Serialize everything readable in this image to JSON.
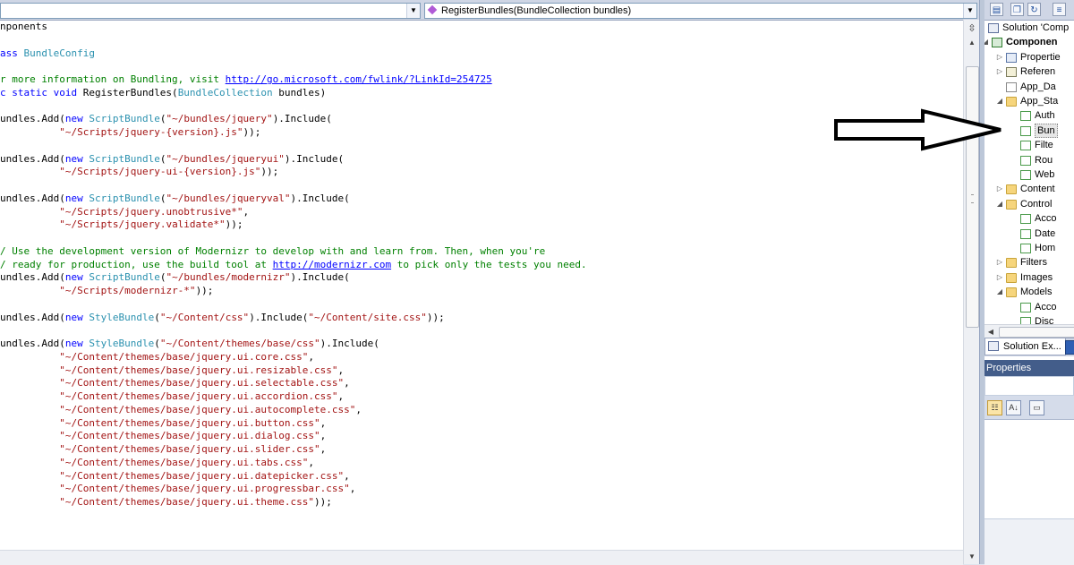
{
  "editor": {
    "type_dropdown": "",
    "member_dropdown": "RegisterBundles(BundleCollection bundles)",
    "code_lines": [
      [
        [
          "nponents",
          ""
        ]
      ],
      [
        [
          "",
          ""
        ]
      ],
      [
        [
          "ass ",
          "k"
        ],
        [
          "BundleConfig",
          "t"
        ]
      ],
      [
        [
          "",
          ""
        ]
      ],
      [
        [
          "r more information on Bundling, visit ",
          "c"
        ],
        [
          "http://go.microsoft.com/fwlink/?LinkId=254725",
          "u"
        ]
      ],
      [
        [
          "c static void ",
          "k"
        ],
        [
          "RegisterBundles(",
          ""
        ],
        [
          "BundleCollection",
          "t"
        ],
        [
          " bundles)",
          ""
        ]
      ],
      [
        [
          "",
          ""
        ]
      ],
      [
        [
          "undles.Add(",
          ""
        ],
        [
          "new ",
          "k"
        ],
        [
          "ScriptBundle",
          "t"
        ],
        [
          "(",
          ""
        ],
        [
          "\"~/bundles/jquery\"",
          "s"
        ],
        [
          ").Include(",
          ""
        ]
      ],
      [
        [
          "          ",
          ""
        ],
        [
          "\"~/Scripts/jquery-{version}.js\"",
          "s"
        ],
        [
          "));",
          ""
        ]
      ],
      [
        [
          "",
          ""
        ]
      ],
      [
        [
          "undles.Add(",
          ""
        ],
        [
          "new ",
          "k"
        ],
        [
          "ScriptBundle",
          "t"
        ],
        [
          "(",
          ""
        ],
        [
          "\"~/bundles/jqueryui\"",
          "s"
        ],
        [
          ").Include(",
          ""
        ]
      ],
      [
        [
          "          ",
          ""
        ],
        [
          "\"~/Scripts/jquery-ui-{version}.js\"",
          "s"
        ],
        [
          "));",
          ""
        ]
      ],
      [
        [
          "",
          ""
        ]
      ],
      [
        [
          "undles.Add(",
          ""
        ],
        [
          "new ",
          "k"
        ],
        [
          "ScriptBundle",
          "t"
        ],
        [
          "(",
          ""
        ],
        [
          "\"~/bundles/jqueryval\"",
          "s"
        ],
        [
          ").Include(",
          ""
        ]
      ],
      [
        [
          "          ",
          ""
        ],
        [
          "\"~/Scripts/jquery.unobtrusive*\"",
          "s"
        ],
        [
          ",",
          ""
        ]
      ],
      [
        [
          "          ",
          ""
        ],
        [
          "\"~/Scripts/jquery.validate*\"",
          "s"
        ],
        [
          "));",
          ""
        ]
      ],
      [
        [
          "",
          ""
        ]
      ],
      [
        [
          "/ Use the development version of Modernizr to develop with and learn from. Then, when you're",
          "c"
        ]
      ],
      [
        [
          "/ ready for production, use the build tool at ",
          "c"
        ],
        [
          "http://modernizr.com",
          "u"
        ],
        [
          " to pick only the tests you need.",
          "c"
        ]
      ],
      [
        [
          "undles.Add(",
          ""
        ],
        [
          "new ",
          "k"
        ],
        [
          "ScriptBundle",
          "t"
        ],
        [
          "(",
          ""
        ],
        [
          "\"~/bundles/modernizr\"",
          "s"
        ],
        [
          ").Include(",
          ""
        ]
      ],
      [
        [
          "          ",
          ""
        ],
        [
          "\"~/Scripts/modernizr-*\"",
          "s"
        ],
        [
          "));",
          ""
        ]
      ],
      [
        [
          "",
          ""
        ]
      ],
      [
        [
          "undles.Add(",
          ""
        ],
        [
          "new ",
          "k"
        ],
        [
          "StyleBundle",
          "t"
        ],
        [
          "(",
          ""
        ],
        [
          "\"~/Content/css\"",
          "s"
        ],
        [
          ").Include(",
          ""
        ],
        [
          "\"~/Content/site.css\"",
          "s"
        ],
        [
          "));",
          ""
        ]
      ],
      [
        [
          "",
          ""
        ]
      ],
      [
        [
          "undles.Add(",
          ""
        ],
        [
          "new ",
          "k"
        ],
        [
          "StyleBundle",
          "t"
        ],
        [
          "(",
          ""
        ],
        [
          "\"~/Content/themes/base/css\"",
          "s"
        ],
        [
          ").Include(",
          ""
        ]
      ],
      [
        [
          "          ",
          ""
        ],
        [
          "\"~/Content/themes/base/jquery.ui.core.css\"",
          "s"
        ],
        [
          ",",
          ""
        ]
      ],
      [
        [
          "          ",
          ""
        ],
        [
          "\"~/Content/themes/base/jquery.ui.resizable.css\"",
          "s"
        ],
        [
          ",",
          ""
        ]
      ],
      [
        [
          "          ",
          ""
        ],
        [
          "\"~/Content/themes/base/jquery.ui.selectable.css\"",
          "s"
        ],
        [
          ",",
          ""
        ]
      ],
      [
        [
          "          ",
          ""
        ],
        [
          "\"~/Content/themes/base/jquery.ui.accordion.css\"",
          "s"
        ],
        [
          ",",
          ""
        ]
      ],
      [
        [
          "          ",
          ""
        ],
        [
          "\"~/Content/themes/base/jquery.ui.autocomplete.css\"",
          "s"
        ],
        [
          ",",
          ""
        ]
      ],
      [
        [
          "          ",
          ""
        ],
        [
          "\"~/Content/themes/base/jquery.ui.button.css\"",
          "s"
        ],
        [
          ",",
          ""
        ]
      ],
      [
        [
          "          ",
          ""
        ],
        [
          "\"~/Content/themes/base/jquery.ui.dialog.css\"",
          "s"
        ],
        [
          ",",
          ""
        ]
      ],
      [
        [
          "          ",
          ""
        ],
        [
          "\"~/Content/themes/base/jquery.ui.slider.css\"",
          "s"
        ],
        [
          ",",
          ""
        ]
      ],
      [
        [
          "          ",
          ""
        ],
        [
          "\"~/Content/themes/base/jquery.ui.tabs.css\"",
          "s"
        ],
        [
          ",",
          ""
        ]
      ],
      [
        [
          "          ",
          ""
        ],
        [
          "\"~/Content/themes/base/jquery.ui.datepicker.css\"",
          "s"
        ],
        [
          ",",
          ""
        ]
      ],
      [
        [
          "          ",
          ""
        ],
        [
          "\"~/Content/themes/base/jquery.ui.progressbar.css\"",
          "s"
        ],
        [
          ",",
          ""
        ]
      ],
      [
        [
          "          ",
          ""
        ],
        [
          "\"~/Content/themes/base/jquery.ui.theme.css\"",
          "s"
        ],
        [
          "));",
          ""
        ]
      ]
    ],
    "colors": {
      "keyword": "#0000ff",
      "type": "#2b91af",
      "string": "#a31515",
      "comment": "#008000"
    }
  },
  "solution_explorer": {
    "toolbar_icons": [
      "properties-icon",
      "show-all-files-icon",
      "refresh-icon",
      "view-code-icon"
    ],
    "tree": [
      {
        "label": "Solution 'Comp",
        "icon": "sol",
        "expander": "",
        "indent": 0
      },
      {
        "label": "Componen",
        "icon": "proj",
        "expander": "expanded",
        "indent": 1,
        "bold": true
      },
      {
        "label": "Propertie",
        "icon": "props",
        "expander": "collapsed",
        "indent": 2
      },
      {
        "label": "Referen",
        "icon": "refs",
        "expander": "collapsed",
        "indent": 2
      },
      {
        "label": "App_Da",
        "icon": "file",
        "expander": "",
        "indent": 2
      },
      {
        "label": "App_Sta",
        "icon": "folder",
        "expander": "expanded",
        "indent": 2
      },
      {
        "label": "Auth",
        "icon": "cs",
        "expander": "",
        "indent": 3
      },
      {
        "label": "Bun",
        "icon": "cs",
        "expander": "",
        "indent": 3,
        "selected": true
      },
      {
        "label": "Filte",
        "icon": "cs",
        "expander": "",
        "indent": 3
      },
      {
        "label": "Rou",
        "icon": "cs",
        "expander": "",
        "indent": 3
      },
      {
        "label": "Web",
        "icon": "cs",
        "expander": "",
        "indent": 3
      },
      {
        "label": "Content",
        "icon": "folder",
        "expander": "collapsed",
        "indent": 2
      },
      {
        "label": "Control",
        "icon": "folder",
        "expander": "expanded",
        "indent": 2
      },
      {
        "label": "Acco",
        "icon": "cs",
        "expander": "",
        "indent": 3
      },
      {
        "label": "Date",
        "icon": "cs",
        "expander": "",
        "indent": 3
      },
      {
        "label": "Hom",
        "icon": "cs",
        "expander": "",
        "indent": 3
      },
      {
        "label": "Filters",
        "icon": "folder",
        "expander": "collapsed",
        "indent": 2
      },
      {
        "label": "Images",
        "icon": "folder",
        "expander": "collapsed",
        "indent": 2
      },
      {
        "label": "Models",
        "icon": "folder",
        "expander": "expanded",
        "indent": 2
      },
      {
        "label": "Acco",
        "icon": "cs",
        "expander": "",
        "indent": 3
      },
      {
        "label": "Disc",
        "icon": "cs",
        "expander": "",
        "indent": 3
      }
    ],
    "tab_label": "Solution Ex..."
  },
  "properties": {
    "title": "Properties",
    "toolbar_icons": [
      "categorized-icon",
      "alphabetical-icon",
      "property-pages-icon"
    ]
  }
}
